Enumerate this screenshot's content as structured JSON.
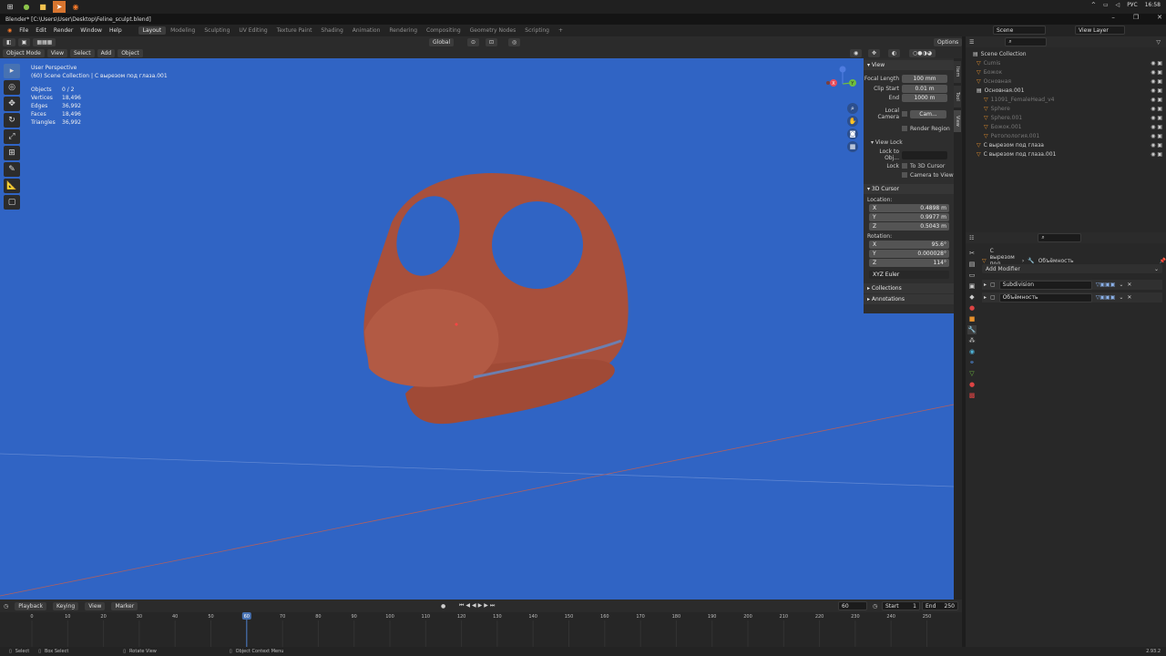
{
  "taskbar": {
    "lang": "РУС",
    "time": "16:58"
  },
  "window": {
    "title": "Blender* [C:\\Users\\User\\Desktop\\Feline_sculpt.blend]"
  },
  "menus": [
    "File",
    "Edit",
    "Render",
    "Window",
    "Help"
  ],
  "workspaces": [
    "Layout",
    "Modeling",
    "Sculpting",
    "UV Editing",
    "Texture Paint",
    "Shading",
    "Animation",
    "Rendering",
    "Compositing",
    "Geometry Nodes",
    "Scripting"
  ],
  "scene_field": "Scene",
  "view_layer_field": "View Layer",
  "viewport_header": {
    "transform_orient": "Global",
    "options": "Options"
  },
  "viewport_header2": {
    "mode": "Object Mode",
    "view": "View",
    "select": "Select",
    "add": "Add",
    "object": "Object"
  },
  "overlay": {
    "perspective": "User Perspective",
    "collection": "(60) Scene Collection | С вырезом под глаза.001",
    "stats": [
      {
        "label": "Objects",
        "value": "0 / 2"
      },
      {
        "label": "Vertices",
        "value": "18,496"
      },
      {
        "label": "Edges",
        "value": "36,992"
      },
      {
        "label": "Faces",
        "value": "18,496"
      },
      {
        "label": "Triangles",
        "value": "36,992"
      }
    ]
  },
  "npanel": {
    "view_title": "View",
    "focal_label": "Focal Length",
    "focal_value": "100 mm",
    "clip_start_label": "Clip Start",
    "clip_start_value": "0.01 m",
    "end_label": "End",
    "end_value": "1000 m",
    "local_camera_label": "Local Camera",
    "local_camera_value": "Cam...",
    "render_region": "Render Region",
    "view_lock_title": "View Lock",
    "lock_obj_label": "Lock to Obj...",
    "lock_label": "Lock",
    "to_cursor": "To 3D Cursor",
    "camera_to_view": "Camera to View",
    "cursor_title": "3D Cursor",
    "location_label": "Location:",
    "loc": [
      {
        "axis": "X",
        "value": "0.4898 m"
      },
      {
        "axis": "Y",
        "value": "0.9977 m"
      },
      {
        "axis": "Z",
        "value": "0.5043 m"
      }
    ],
    "rotation_label": "Rotation:",
    "rot": [
      {
        "axis": "X",
        "value": "95.6°"
      },
      {
        "axis": "Y",
        "value": "0.000028°"
      },
      {
        "axis": "Z",
        "value": "114°"
      }
    ],
    "euler": "XYZ Euler",
    "collections": "Collections",
    "annotations": "Annotations",
    "tabs": [
      "Item",
      "Tool",
      "View"
    ]
  },
  "outliner": {
    "root": "Scene Collection",
    "rows": [
      {
        "name": "Cumis",
        "dim": true,
        "indent": 1
      },
      {
        "name": "Божок",
        "dim": true,
        "indent": 1
      },
      {
        "name": "Основная",
        "dim": true,
        "indent": 1
      },
      {
        "name": "Основная.001",
        "dim": false,
        "indent": 1
      },
      {
        "name": "11091_FemaleHead_v4",
        "dim": true,
        "indent": 2
      },
      {
        "name": "Sphere",
        "dim": true,
        "indent": 2
      },
      {
        "name": "Sphere.001",
        "dim": true,
        "indent": 2
      },
      {
        "name": "Божок.001",
        "dim": true,
        "indent": 2
      },
      {
        "name": "Ретопология.001",
        "dim": true,
        "indent": 2
      },
      {
        "name": "С вырезом под глаза",
        "dim": false,
        "indent": 1
      },
      {
        "name": "С вырезом под глаза.001",
        "dim": false,
        "indent": 1
      }
    ]
  },
  "properties": {
    "object_name": "С вырезом под глаза.001",
    "modifier_name": "Объёмность",
    "add_modifier": "Add Modifier",
    "modifiers": [
      "Subdivision",
      "Объёмность"
    ]
  },
  "timeline": {
    "playback": "Playback",
    "keying": "Keying",
    "view": "View",
    "marker": "Marker",
    "current_frame": "60",
    "start_label": "Start",
    "start": "1",
    "end_label": "End",
    "end": "250",
    "ticks": [
      "0",
      "10",
      "20",
      "30",
      "40",
      "50",
      "60",
      "70",
      "80",
      "90",
      "100",
      "110",
      "120",
      "130",
      "140",
      "150",
      "160",
      "170",
      "180",
      "190",
      "200",
      "210",
      "220",
      "230",
      "240",
      "250"
    ],
    "current": 60
  },
  "status": {
    "select": "Select",
    "box_select": "Box Select",
    "rotate_view": "Rotate View",
    "context_menu": "Object Context Menu",
    "version": "2.93.2"
  },
  "colors": {
    "viewport": "#3064c4",
    "mesh": "#a8503c",
    "accent": "#4772b3"
  }
}
